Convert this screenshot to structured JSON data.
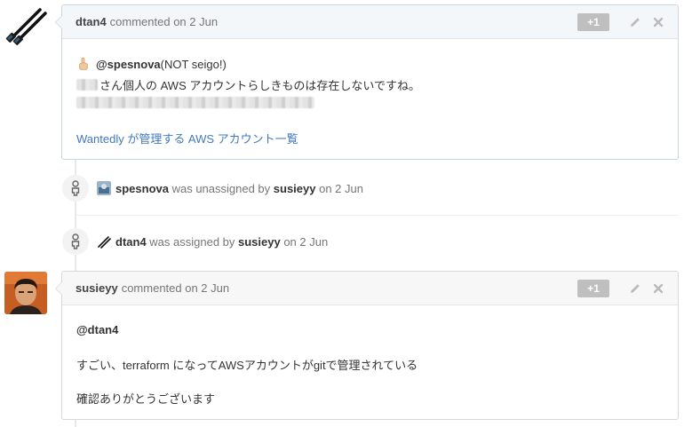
{
  "comment1": {
    "author": "dtan4",
    "meta": "commented on 2 Jun",
    "plus_one": "+1",
    "mention": "@spesnova",
    "mention_suffix": " (NOT seigo!)",
    "line2": "さん個人の AWS アカウントらしきものは存在しないですね。",
    "link_text": "Wantedly が管理する AWS アカウント一覧"
  },
  "event1": {
    "user": "spesnova",
    "action": " was unassigned by ",
    "actor": "susieyy",
    "time": " on 2 Jun"
  },
  "event2": {
    "user": "dtan4",
    "action": " was assigned by ",
    "actor": "susieyy",
    "time": " on 2 Jun"
  },
  "comment2": {
    "author": "susieyy",
    "meta": "commented on 2 Jun",
    "plus_one": "+1",
    "line1": "@dtan4",
    "line2": "すごい、terraform になってAWSアカウントがgitで管理されている",
    "line3": "確認ありがとうございます"
  },
  "icons": {
    "edit": "pencil-icon",
    "delete": "close-icon",
    "event": "person-icon",
    "finger": "pointing-up-emoji"
  },
  "colors": {
    "link": "#4078c0",
    "header_bg": "#f3f7fa",
    "plus_one_bg": "#bfbfbf"
  }
}
